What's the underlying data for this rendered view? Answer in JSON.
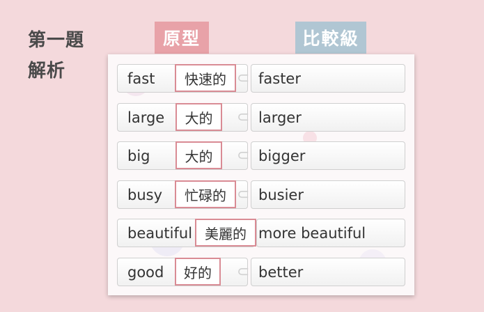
{
  "header": {
    "title_line1": "第一題",
    "title_line2": "解析",
    "tag_original": "原型",
    "tag_comparative": "比較級"
  },
  "rows": [
    {
      "base": "fast",
      "meaning": "快速的",
      "comparative": "faster"
    },
    {
      "base": "large",
      "meaning": "大的",
      "comparative": "larger"
    },
    {
      "base": "big",
      "meaning": "大的",
      "comparative": "bigger"
    },
    {
      "base": "busy",
      "meaning": "忙碌的",
      "comparative": "busier"
    },
    {
      "base": "beautiful",
      "meaning": "美麗的",
      "comparative": "more beautiful"
    },
    {
      "base": "good",
      "meaning": "好的",
      "comparative": "better"
    }
  ],
  "colors": {
    "background": "#f4d9dc",
    "tag_original": "#e8a2a8",
    "tag_comparative": "#b0c6d3",
    "meaning_border": "#d98b94"
  }
}
